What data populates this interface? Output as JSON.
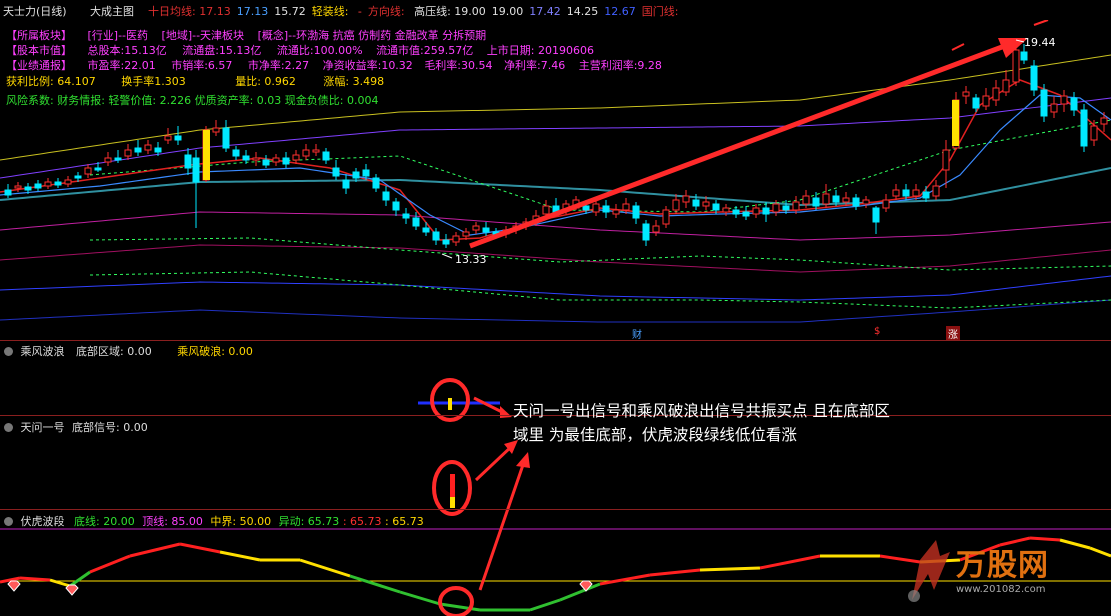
{
  "topbar": {
    "app": "天士力(日线)",
    "indicator": "大成主图",
    "items": [
      {
        "label": "十日均线: ",
        "value": "17.13",
        "color": "#e03030"
      },
      {
        "label": "",
        "value": "17.13",
        "color": "#4aa0ff"
      },
      {
        "label": "",
        "value": "15.72",
        "color": "#e0e0e0"
      },
      {
        "label": "轻装线: ",
        "value": "",
        "color": "#ffd700"
      },
      {
        "label": "",
        "value": "-",
        "color": "#ff4040"
      },
      {
        "label": "方向线: ",
        "value": "",
        "color": "#e03030"
      },
      {
        "label": "高压线: ",
        "value": "19.00",
        "color": "#e0e0e0"
      },
      {
        "label": "",
        "value": "19.00",
        "color": "#e0e0e0"
      },
      {
        "label": "",
        "value": "17.42",
        "color": "#8080ff"
      },
      {
        "label": "",
        "value": "14.25",
        "color": "#e0e0e0"
      },
      {
        "label": "",
        "value": "12.67",
        "color": "#4060ff"
      },
      {
        "label": "国门线: ",
        "value": "",
        "color": "#e03030"
      }
    ]
  },
  "info": {
    "row1": [
      "【所属板块】",
      "[行业]--医药",
      "[地域]--天津板块",
      "[概念]--环渤海 抗癌 仿制药 金融改革 分拆预期"
    ],
    "row2": [
      "【股本市值】",
      "总股本:15.13亿",
      "流通盘:15.13亿",
      "流通比:100.00%",
      "流通市值:259.57亿",
      "上市日期: 20190606"
    ],
    "row3": [
      "【业绩通报】",
      "市盈率:22.01",
      "市销率:6.57",
      "市净率:2.27",
      "净资收益率:10.32",
      "毛利率:30.54",
      "净利率:7.46",
      "主营利润率:9.28"
    ],
    "row4": [
      "获利比例: ",
      "64.107",
      "换手率",
      "1.303",
      "量比: ",
      "0.962",
      "涨幅: ",
      "3.498"
    ],
    "row5": "风险系数: 财务情报: 轻警价值: 2.226 优质资产率: 0.03 现金负债比: 0.004"
  },
  "price_labels": {
    "high": "19.44",
    "low": "13.33"
  },
  "event_marks": {
    "cai": "财",
    "s": "$",
    "zhang": "涨"
  },
  "panels": {
    "p1": {
      "name": "乘风波浪",
      "f1": "底部区域: 0.00",
      "f2": "乘风破浪: 0.00"
    },
    "p2": {
      "name": "天问一号",
      "f1": "底部信号: 0.00"
    },
    "p3": {
      "name": "伏虎波段",
      "f1": "底线: 20.00",
      "f2": "顶线: 85.00",
      "f3": "中界: 50.00",
      "f4": "异动: 65.73",
      "f5": ": 65.73",
      "f6": ": 65.73"
    }
  },
  "annotation": "天问一号出信号和乘风破浪出信号共振买点 且在底部区域里 为最佳底部，伏虎波段绿线低位看涨",
  "watermark": {
    "name": "万股网",
    "url": "www.201082.com"
  },
  "colors": {
    "up": "#ff3030",
    "down": "#00ffff",
    "annot": "#ff2a2a"
  }
}
